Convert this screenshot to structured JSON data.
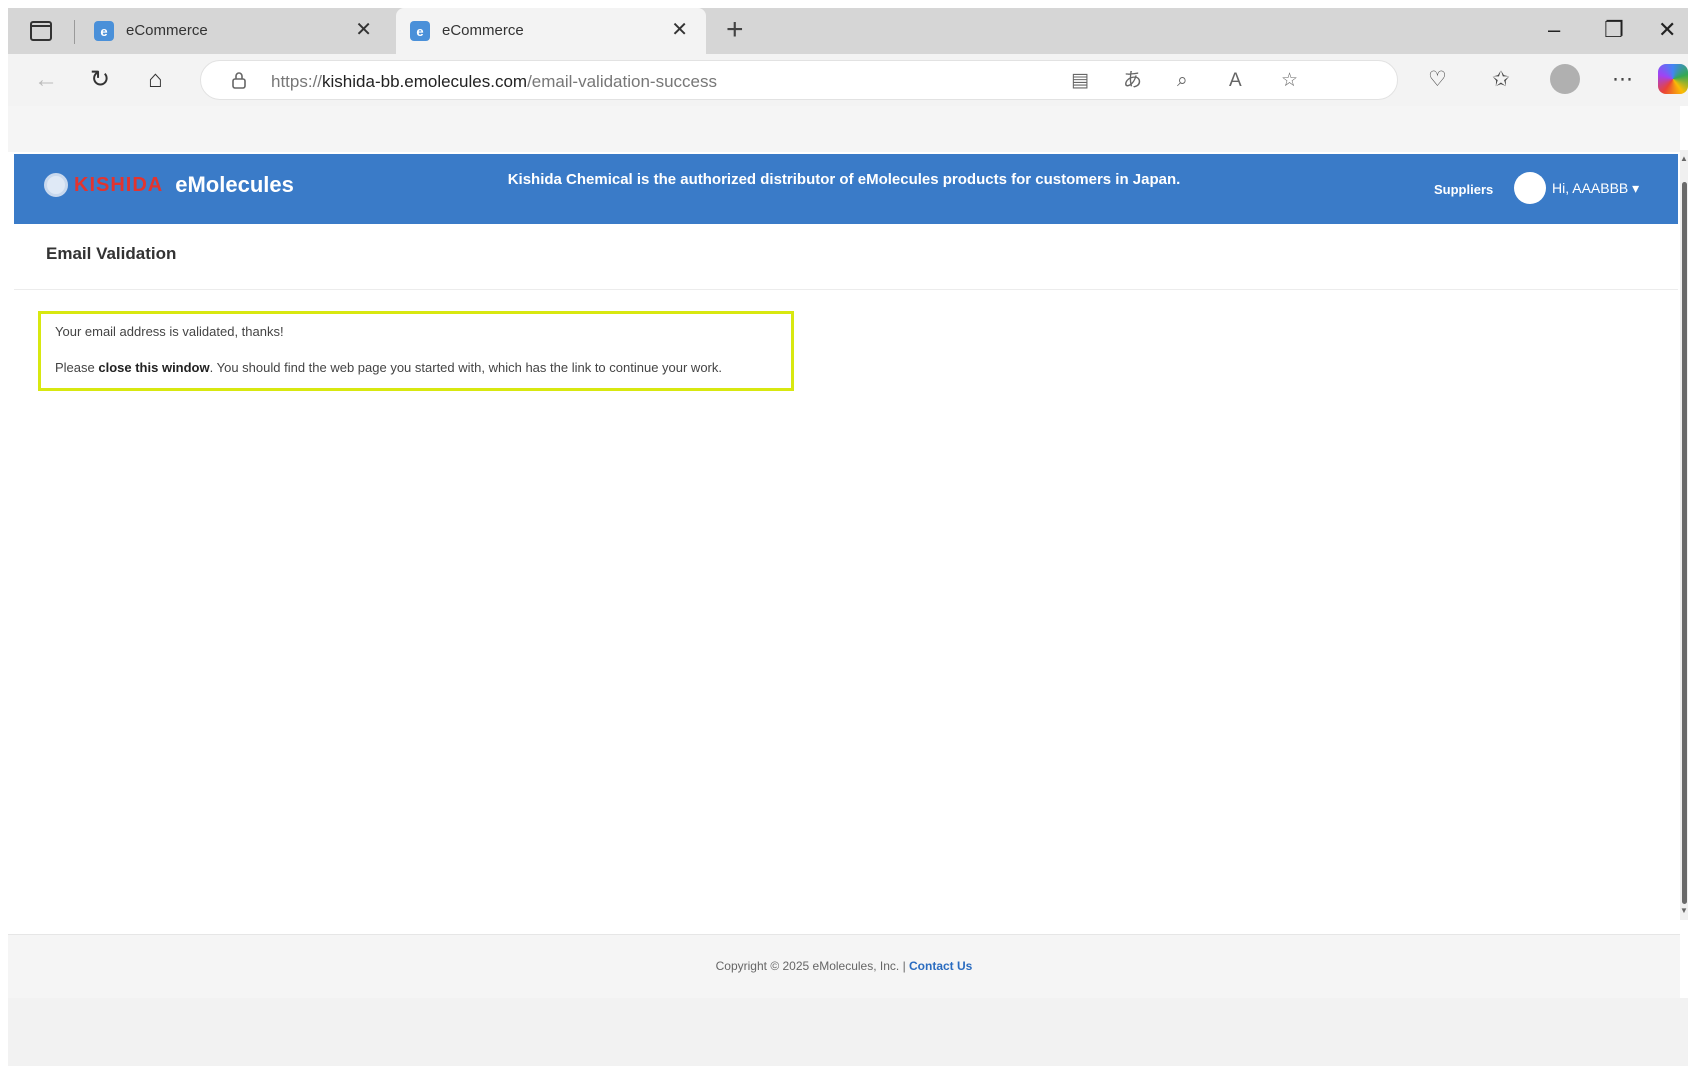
{
  "browser": {
    "tabs": [
      {
        "title": "eCommerce",
        "favicon": "e",
        "active": false
      },
      {
        "title": "eCommerce",
        "favicon": "e",
        "active": true
      }
    ],
    "tab_close_glyph": "✕",
    "new_tab_glyph": "+",
    "url_scheme": "https://",
    "url_host": "kishida-bb.emolecules.com",
    "url_path": "/email-validation-success"
  },
  "header": {
    "logo_brand": "KISHIDA",
    "logo_product": "eMolecules",
    "notice": "Kishida Chemical is the authorized distributor of eMolecules products for customers in Japan.",
    "suppliers_label": "Suppliers",
    "user_greeting": "Hi, AAABBB ▾",
    "accent_color": "#3a7bc8",
    "brand_red": "#e2342f"
  },
  "page": {
    "title": "Email Validation",
    "message_line1": "Your email address is validated, thanks!",
    "message_line2_prefix": "Please ",
    "message_line2_bold": "close this window",
    "message_line2_suffix": ". You should find the web page you started with, which has the link to continue your work.",
    "highlight_color": "#d8e810"
  },
  "footer": {
    "copyright": "Copyright © 2025 eMolecules, Inc. | ",
    "contact_label": "Contact Us"
  }
}
